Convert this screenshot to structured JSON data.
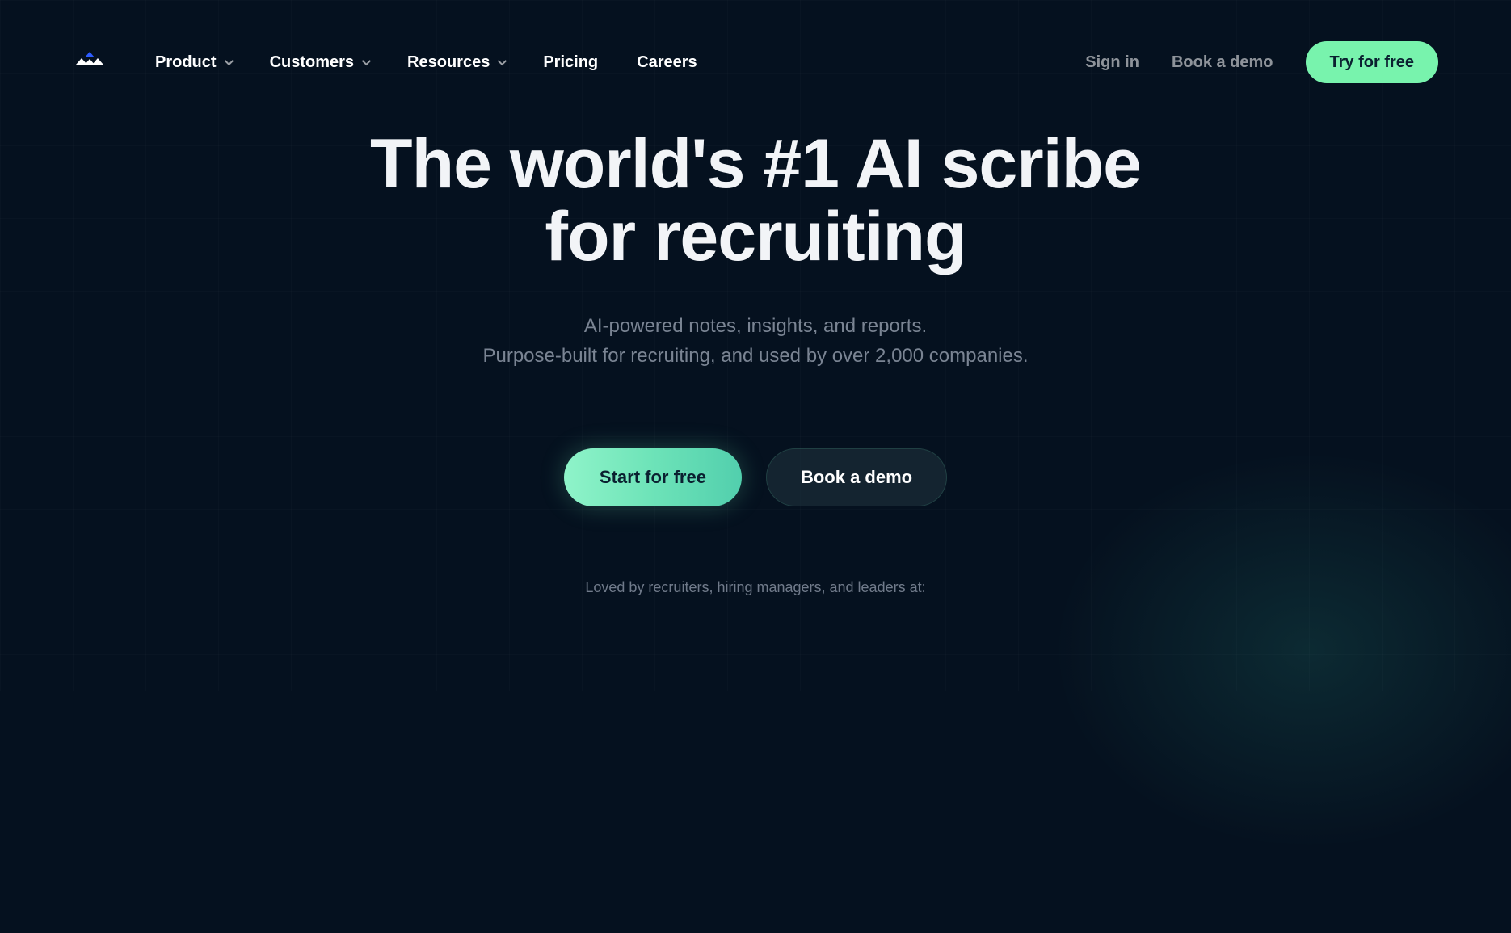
{
  "nav": {
    "items": [
      {
        "label": "Product",
        "hasDropdown": true
      },
      {
        "label": "Customers",
        "hasDropdown": true
      },
      {
        "label": "Resources",
        "hasDropdown": true
      },
      {
        "label": "Pricing",
        "hasDropdown": false
      },
      {
        "label": "Careers",
        "hasDropdown": false
      }
    ],
    "signIn": "Sign in",
    "bookDemo": "Book a demo",
    "tryFree": "Try for free"
  },
  "hero": {
    "titleLine1": "The world's #1 AI scribe",
    "titleLine2": "for recruiting",
    "subLine1": "AI-powered notes, insights, and reports.",
    "subLine2": "Purpose-built for recruiting, and used by over 2,000 companies.",
    "ctaPrimary": "Start for free",
    "ctaSecondary": "Book a demo",
    "socialProof": "Loved by recruiters, hiring managers, and leaders at:"
  }
}
